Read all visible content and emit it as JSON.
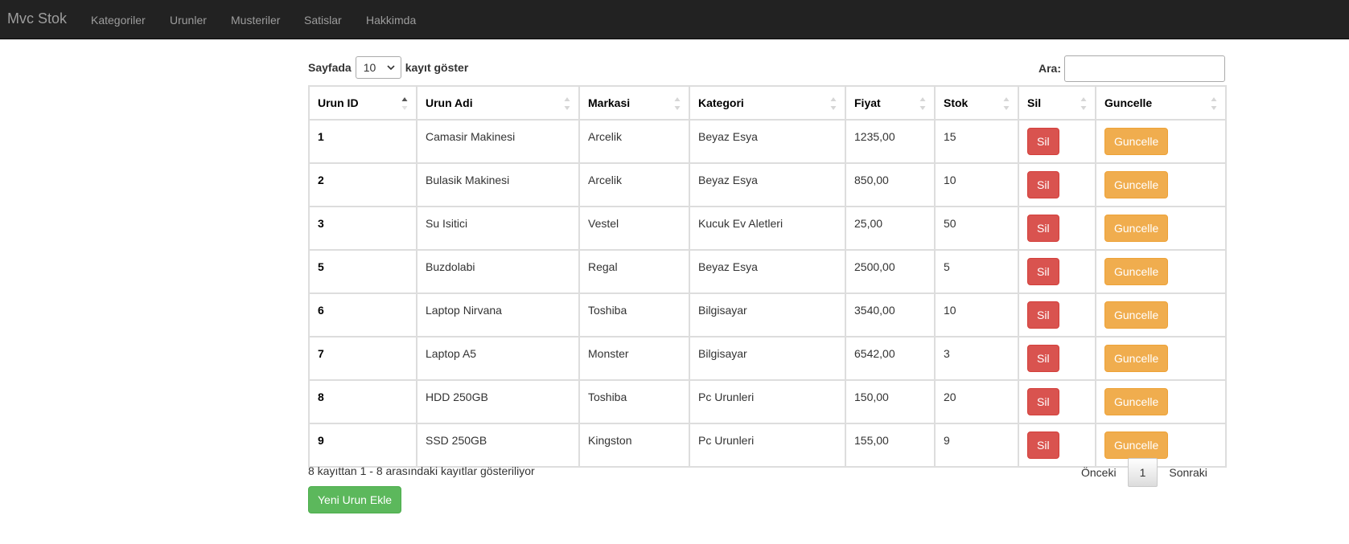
{
  "navbar": {
    "brand": "Mvc Stok",
    "links": [
      "Kategoriler",
      "Urunler",
      "Musteriler",
      "Satislar",
      "Hakkimda"
    ]
  },
  "table_controls": {
    "length_prefix": "Sayfada",
    "length_value": "10",
    "length_suffix": "kayıt göster",
    "search_label": "Ara:",
    "search_value": ""
  },
  "columns": [
    "Urun ID",
    "Urun Adi",
    "Markasi",
    "Kategori",
    "Fiyat",
    "Stok",
    "Sil",
    "Guncelle"
  ],
  "sorted_column": "Urun ID",
  "rows": [
    {
      "id": "1",
      "name": "Camasir Makinesi",
      "brand": "Arcelik",
      "category": "Beyaz Esya",
      "price": "1235,00",
      "stock": "15"
    },
    {
      "id": "2",
      "name": "Bulasik Makinesi",
      "brand": "Arcelik",
      "category": "Beyaz Esya",
      "price": "850,00",
      "stock": "10"
    },
    {
      "id": "3",
      "name": "Su Isitici",
      "brand": "Vestel",
      "category": "Kucuk Ev Aletleri",
      "price": "25,00",
      "stock": "50"
    },
    {
      "id": "5",
      "name": "Buzdolabi",
      "brand": "Regal",
      "category": "Beyaz Esya",
      "price": "2500,00",
      "stock": "5"
    },
    {
      "id": "6",
      "name": "Laptop Nirvana",
      "brand": "Toshiba",
      "category": "Bilgisayar",
      "price": "3540,00",
      "stock": "10"
    },
    {
      "id": "7",
      "name": "Laptop A5",
      "brand": "Monster",
      "category": "Bilgisayar",
      "price": "6542,00",
      "stock": "3"
    },
    {
      "id": "8",
      "name": "HDD 250GB",
      "brand": "Toshiba",
      "category": "Pc Urunleri",
      "price": "150,00",
      "stock": "20"
    },
    {
      "id": "9",
      "name": "SSD 250GB",
      "brand": "Kingston",
      "category": "Pc Urunleri",
      "price": "155,00",
      "stock": "9"
    }
  ],
  "row_actions": {
    "delete_label": "Sil",
    "update_label": "Guncelle"
  },
  "footer": {
    "info": "8 kayıttan 1 - 8 arasındaki kayıtlar gösteriliyor",
    "prev": "Önceki",
    "current_page": "1",
    "next": "Sonraki",
    "add_button": "Yeni Urun Ekle"
  },
  "colors": {
    "navbar": "#222222",
    "danger": "#d9534f",
    "warning": "#f0ad4e",
    "success": "#5cb85c"
  },
  "icons": {
    "sort": "sort-both-icon",
    "sort_asc": "sort-ascending-icon",
    "select": "chevron-down-icon"
  }
}
